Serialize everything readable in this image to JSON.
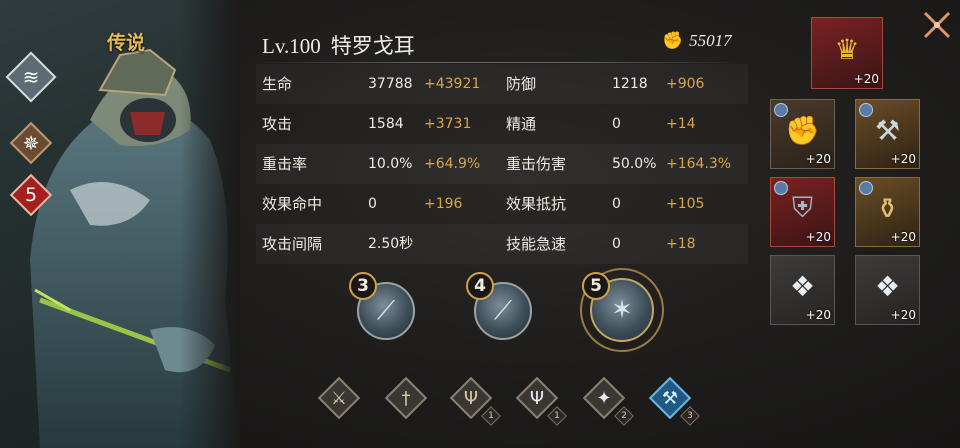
{
  "hero": {
    "rarity": "传说",
    "badges": {
      "element_icon": "wind-icon",
      "class_icon": "star-icon",
      "star_count": "5"
    }
  },
  "header": {
    "level": "Lv.100",
    "name": "特罗戈耳",
    "power_icon": "fist-icon",
    "power": "55017"
  },
  "stats": [
    {
      "label": "生命",
      "base": "37788",
      "bonus": "+43921",
      "label2": "防御",
      "base2": "1218",
      "bonus2": "+906"
    },
    {
      "label": "攻击",
      "base": "1584",
      "bonus": "+3731",
      "label2": "精通",
      "base2": "0",
      "bonus2": "+14"
    },
    {
      "label": "重击率",
      "base": "10.0%",
      "bonus": "+64.9%",
      "label2": "重击伤害",
      "base2": "50.0%",
      "bonus2": "+164.3%"
    },
    {
      "label": "效果命中",
      "base": "0",
      "bonus": "+196",
      "label2": "效果抵抗",
      "base2": "0",
      "bonus2": "+105"
    },
    {
      "label": "攻击间隔",
      "base": "2.50秒",
      "bonus": "",
      "label2": "技能急速",
      "base2": "0",
      "bonus2": "+18"
    }
  ],
  "skills": [
    {
      "level": "3",
      "icon": "claw-slash-icon"
    },
    {
      "level": "4",
      "icon": "beast-strike-icon"
    },
    {
      "level": "5",
      "icon": "ultimate-roar-icon"
    }
  ],
  "runes": [
    {
      "icon": "sword-icon",
      "count": ""
    },
    {
      "icon": "sword-in-stone-icon",
      "count": ""
    },
    {
      "icon": "triple-strike-icon",
      "count": "1"
    },
    {
      "icon": "triple-strike-silver-icon",
      "count": "1"
    },
    {
      "icon": "beast-claw-icon",
      "count": "2"
    },
    {
      "icon": "double-axe-icon",
      "count": "3"
    }
  ],
  "equipment": [
    {
      "slot": "crown",
      "level": "+20",
      "icon": "thorn-crown-icon"
    },
    {
      "slot": "weapon-1",
      "level": "+20",
      "icon": "gauntlet-icon"
    },
    {
      "slot": "weapon-2",
      "level": "+20",
      "icon": "hammer-icon"
    },
    {
      "slot": "armor",
      "level": "+20",
      "icon": "armor-icon"
    },
    {
      "slot": "bracer",
      "level": "+20",
      "icon": "bracer-icon"
    },
    {
      "slot": "crystal-1",
      "level": "+20",
      "icon": "crystal-icon"
    },
    {
      "slot": "crystal-2",
      "level": "+20",
      "icon": "crystal-icon"
    }
  ],
  "colors": {
    "bonus": "#d9a54a",
    "gold_accent": "#e6bb55",
    "star_badge": "#a51f1f"
  }
}
